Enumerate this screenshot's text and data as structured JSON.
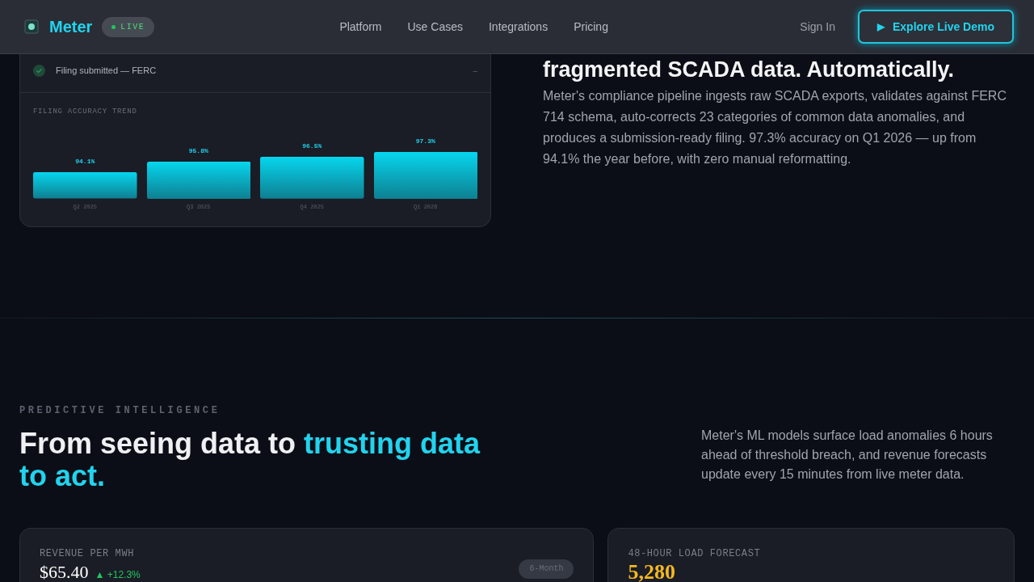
{
  "nav": {
    "brand": "Meter",
    "badge": "LIVE",
    "links": [
      "Platform",
      "Use Cases",
      "Integrations",
      "Pricing"
    ],
    "sign_in": "Sign In",
    "cta": {
      "icon": "▶",
      "label": "Explore Live Demo"
    }
  },
  "filing_card": {
    "status_row": {
      "label": "Filing submitted — FERC",
      "value": "–",
      "done": true
    },
    "chart": {
      "title": "FILING ACCURACY TREND",
      "chart_data": {
        "type": "bar",
        "categories": [
          "Q2 2025",
          "Q3 2025",
          "Q4 2025",
          "Q1 2026"
        ],
        "values": [
          94.1,
          95.8,
          96.5,
          97.3
        ],
        "value_labels": [
          "94.1%",
          "95.8%",
          "96.5%",
          "97.3%"
        ],
        "ylim": [
          90,
          97.3
        ],
        "data_labels": true
      }
    }
  },
  "compliance": {
    "heading": "fragmented SCADA data. Automatically.",
    "body": "Meter's compliance pipeline ingests raw SCADA exports, validates against FERC 714 schema, auto-corrects 23 categories of common data anomalies, and produces a submission-ready filing. 97.3% accuracy on Q1 2026 — up from 94.1% the year before, with zero manual reformatting."
  },
  "predictive": {
    "eyebrow": "PREDICTIVE INTELLIGENCE",
    "heading_plain": "From seeing data to ",
    "heading_accent": "trusting data to act.",
    "body": "Meter's ML models surface load anomalies 6 hours ahead of threshold breach, and revenue forecasts update every 15 minutes from live meter data."
  },
  "cards": [
    {
      "title": "REVENUE PER MWH",
      "value": "$65.40",
      "change": "▲ +12.3%",
      "pill": "6-Month"
    },
    {
      "title": "48-HOUR LOAD FORECAST",
      "value": "5,280"
    }
  ]
}
